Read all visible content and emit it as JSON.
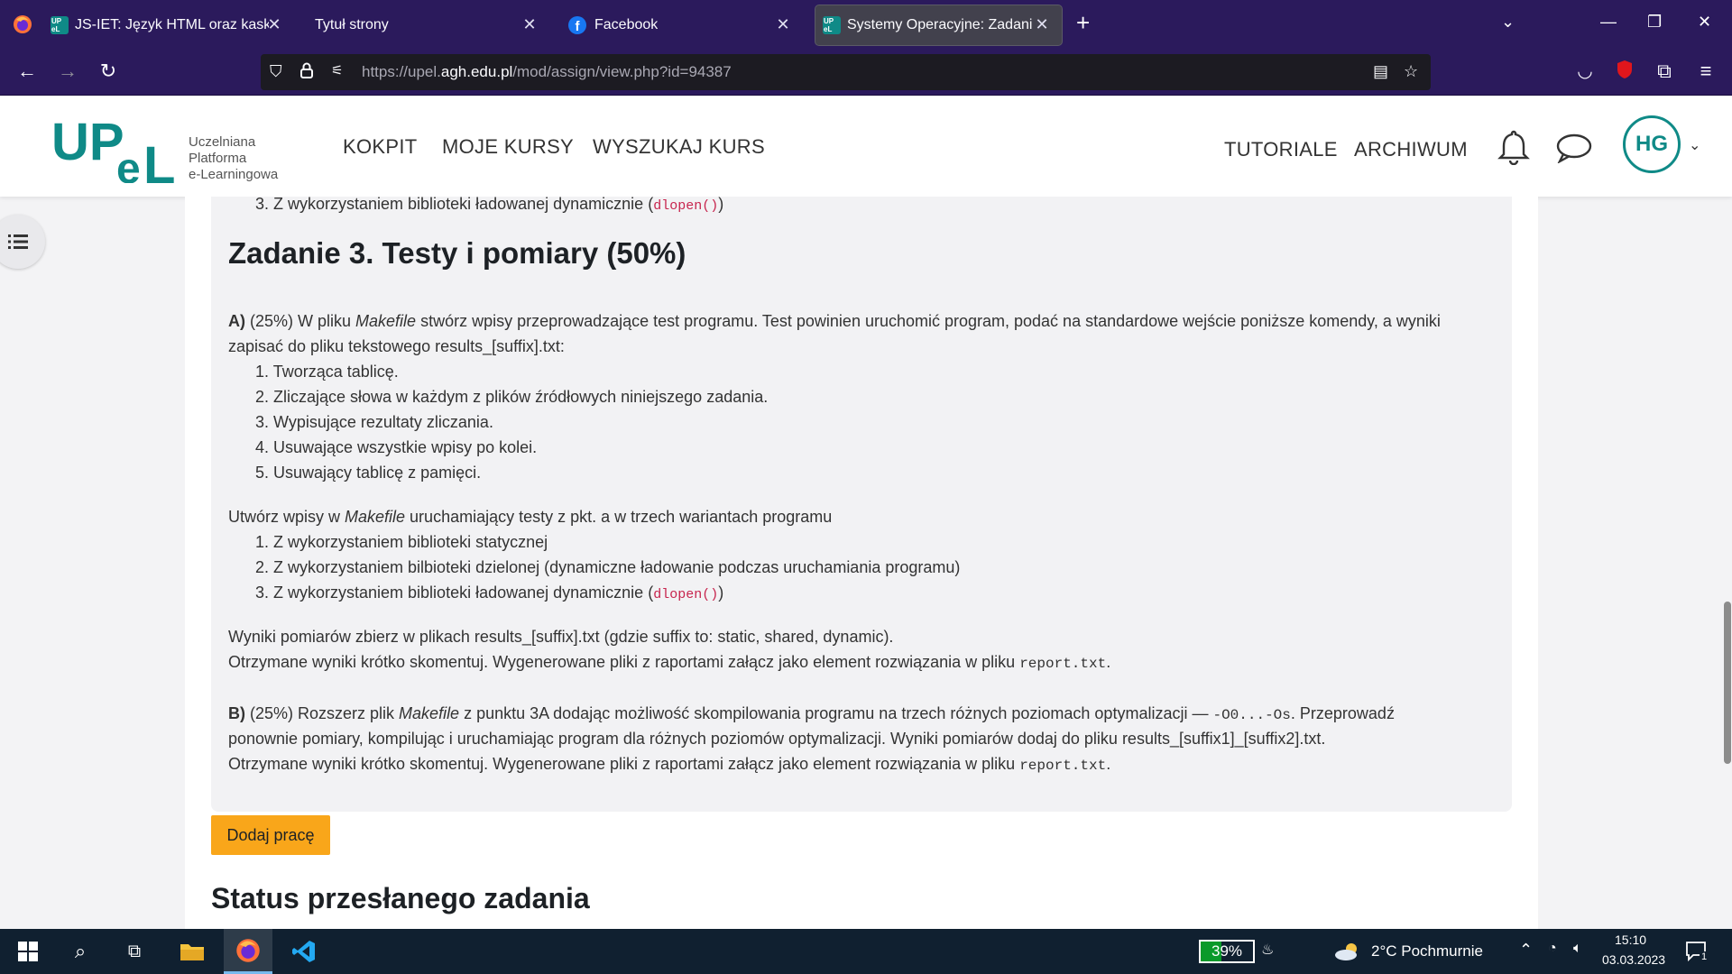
{
  "browser": {
    "tabs": [
      {
        "title": "JS-IET: Język HTML oraz kaskado",
        "favicon": "upel-icon"
      },
      {
        "title": "Tytuł strony",
        "favicon": ""
      },
      {
        "title": "Facebook",
        "favicon": "facebook-icon"
      },
      {
        "title": "Systemy Operacyjne: Zadania - ",
        "favicon": "upel-icon",
        "active": true
      }
    ],
    "url_prefix": "https://upel.",
    "url_domain": "agh.edu.pl",
    "url_path": "/mod/assign/view.php?id=94387"
  },
  "header": {
    "logo_text": "UPeL",
    "logo_sub_1": "Uczelniana",
    "logo_sub_2": "Platforma",
    "logo_sub_3": "e-Learningowa",
    "nav": [
      "KOKPIT",
      "MOJE KURSY",
      "WYSZUKAJ KURS"
    ],
    "right_nav": [
      "TUTORIALE",
      "ARCHIWUM"
    ],
    "avatar_initials": "HG"
  },
  "content": {
    "prev_item": "3. Z wykorzystaniem biblioteki ładowanej dynamicznie (",
    "prev_item_code": "dlopen()",
    "prev_item_end": ")",
    "heading": "Zadanie 3. Testy i pomiary (50%)",
    "a_label": "A)",
    "a_text_1": " (25%) W pliku ",
    "a_makefile": "Makefile",
    "a_text_2": " stwórz wpisy przeprowadzające test programu. Test powinien uruchomić program, podać na standardowe wejście poniższe komendy, a wyniki",
    "a_text_3": "zapisać do pliku tekstowego results_[suffix].txt:",
    "a_list": [
      "1. Tworząca tablicę.",
      "2. Zliczające słowa w każdym z plików źródłowych niniejszego zadania.",
      "3. Wypisujące rezultaty zliczania.",
      "4. Usuwające wszystkie wpisy po kolei.",
      "5. Usuwający tablicę z pamięci."
    ],
    "variants_1": "Utwórz wpisy w ",
    "variants_makefile": "Makefile",
    "variants_2": " uruchamiający testy z pkt. a w trzech wariantach programu",
    "variants_list": [
      "1. Z wykorzystaniem biblioteki statycznej",
      "2. Z wykorzystaniem bilbioteki dzielonej (dynamiczne ładowanie podczas uruchamiania programu)",
      "3. Z wykorzystaniem biblioteki ładowanej dynamicznie ("
    ],
    "variants_code": "dlopen()",
    "variants_code_end": ")",
    "results_1": "Wyniki pomiarów zbierz w plikach results_[suffix].txt (gdzie suffix to: static, shared, dynamic).",
    "results_2": "Otrzymane wyniki krótko skomentuj. Wygenerowane pliki z raportami załącz jako element rozwiązania w pliku ",
    "report_file": "report.txt",
    "b_label": "B)",
    "b_text_1": " (25%) Rozszerz plik ",
    "b_makefile": "Makefile",
    "b_text_2": " z punktu 3A dodając możliwość skompilowania programu na trzech różnych poziomach optymalizacji — ",
    "b_code": "-O0...-Os",
    "b_text_3": ". Przeprowadź",
    "b_text_4": "ponownie pomiary, kompilując i uruchamiając program dla różnych poziomów optymalizacji. Wyniki pomiarów dodaj do pliku results_[suffix1]_[suffix2].txt.",
    "b_text_5": "Otrzymane wyniki krótko skomentuj. Wygenerowane pliki z raportami załącz jako element rozwiązania w pliku ",
    "add_button": "Dodaj pracę",
    "status_heading": "Status przesłanego zadania",
    "period": "."
  },
  "taskbar": {
    "battery": "39%",
    "weather": "2°C  Pochmurnie",
    "time": "15:10",
    "date": "03.03.2023",
    "notifications": "1"
  },
  "colors": {
    "brand": "#0f8a87",
    "chrome": "#2b1a5c",
    "button": "#f9a61a",
    "code": "#c7254e"
  }
}
